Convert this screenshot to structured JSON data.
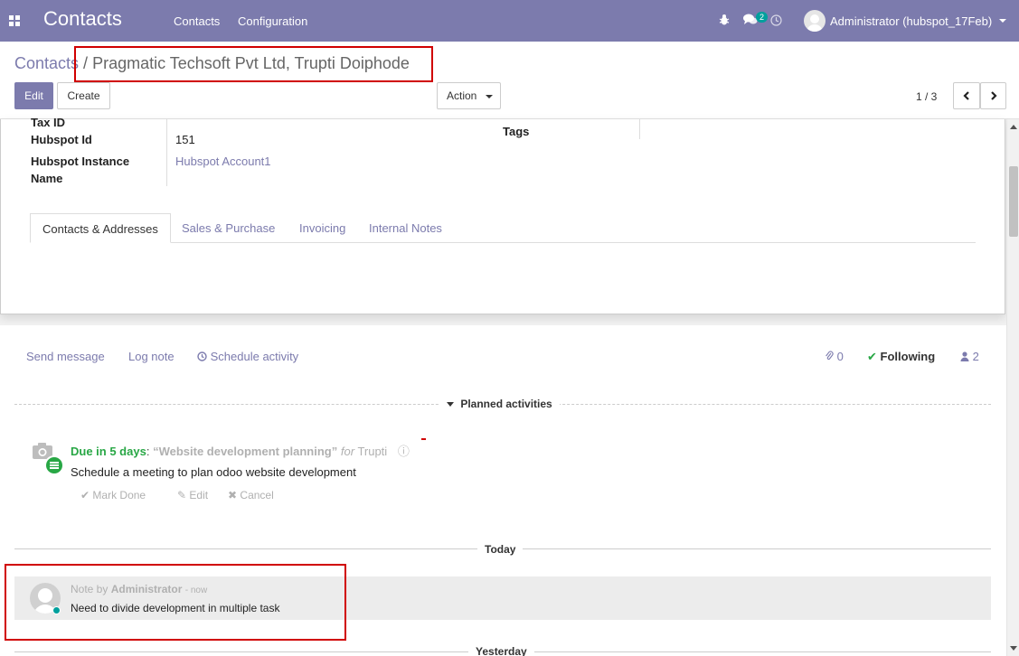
{
  "navbar": {
    "brand": "Contacts",
    "menu": [
      "Contacts",
      "Configuration"
    ],
    "messages_badge": "2",
    "user": "Administrator (hubspot_17Feb)",
    "bg_color": "#7c7bad"
  },
  "breadcrumb": {
    "parent": "Contacts",
    "separator": " / ",
    "current": "Pragmatic Techsoft Pvt Ltd, Trupti Doiphode"
  },
  "toolbar": {
    "edit_label": "Edit",
    "create_label": "Create",
    "action_label": "Action",
    "pager": "1 / 3"
  },
  "form": {
    "tax_id_label": "Tax ID",
    "hubspot_id_label": "Hubspot Id",
    "hubspot_id_value": "151",
    "hubspot_instance_label_1": "Hubspot Instance",
    "hubspot_instance_label_2": "Name",
    "hubspot_instance_value": "Hubspot Account1",
    "tags_label": "Tags",
    "tabs": [
      "Contacts & Addresses",
      "Sales & Purchase",
      "Invoicing",
      "Internal Notes"
    ]
  },
  "chatter": {
    "send_message": "Send message",
    "log_note": "Log note",
    "schedule_activity": "Schedule activity",
    "attachments_count": "0",
    "following": "Following",
    "followers_count": "2",
    "planned_activities": "Planned activities",
    "activity": {
      "due": "Due in 5 days",
      "colon": ":",
      "summary": "“Website development planning”",
      "for_word": "for",
      "assignee": "Trupti",
      "note": "Schedule a meeting to plan odoo website development",
      "mark_done": "Mark Done",
      "edit": "Edit",
      "cancel": "Cancel"
    },
    "today": "Today",
    "yesterday": "Yesterday",
    "message": {
      "note_by": "Note by",
      "author": "Administrator",
      "time": "- now",
      "body": "Need to divide development in multiple task"
    }
  }
}
